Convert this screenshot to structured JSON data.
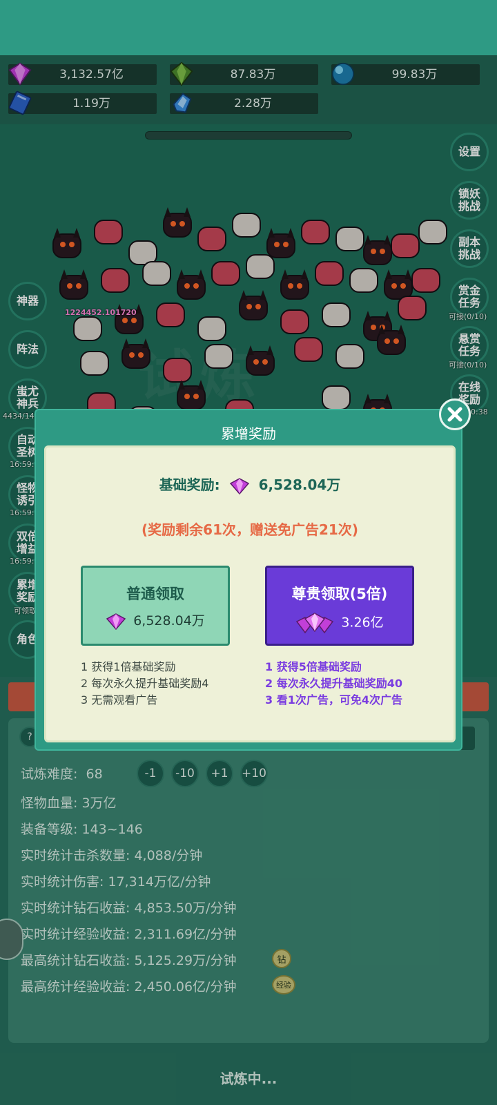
{
  "resources": [
    {
      "name": "diamond",
      "value": "3,132.57亿"
    },
    {
      "name": "green-crystal",
      "value": "87.83万"
    },
    {
      "name": "blue-orb",
      "value": "99.83万"
    },
    {
      "name": "book",
      "value": "1.19万"
    },
    {
      "name": "blue-shard",
      "value": "2.28万"
    }
  ],
  "right_buttons": [
    {
      "label": "设置",
      "sub": ""
    },
    {
      "label": "锁妖挑战",
      "sub": ""
    },
    {
      "label": "副本挑战",
      "sub": ""
    },
    {
      "label": "赏金任务",
      "sub": "可接(0/10)"
    },
    {
      "label": "悬赏任务",
      "sub": "可接(0/10)"
    },
    {
      "label": "在线奖励",
      "sub": "0:38"
    }
  ],
  "left_buttons": [
    {
      "label": "神器",
      "sub": ""
    },
    {
      "label": "阵法",
      "sub": ""
    },
    {
      "label": "蚩尤神兵",
      "sub": "4434/14"
    },
    {
      "label": "自动圣树",
      "sub": "16:59:"
    },
    {
      "label": "怪物诱引",
      "sub": "16:59:"
    },
    {
      "label": "双倍增益",
      "sub": "16:59:"
    },
    {
      "label": "累增奖励",
      "sub": "可领取"
    },
    {
      "label": "角色",
      "sub": ""
    }
  ],
  "damage_text": "1224452.101720",
  "dialog": {
    "title": "累增奖励",
    "base_label": "基础奖励:",
    "base_value": "6,528.04万",
    "remain": "(奖励剩余61次，赠送免广告21次)",
    "normal": {
      "title": "普通领取",
      "amount": "6,528.04万",
      "desc": [
        "1 获得1倍基础奖励",
        "2 每次永久提升基础奖励4",
        "3 无需观看广告"
      ]
    },
    "premium": {
      "title": "尊贵领取(5倍)",
      "amount": "3.26亿",
      "desc": [
        "1 获得5倍基础奖励",
        "2 每次永久提升基础奖励40",
        "3 看1次广告，可免4次广告"
      ]
    }
  },
  "stats": {
    "difficulty_label": "试炼难度:",
    "difficulty_value": "68",
    "adjust": [
      "-1",
      "-10",
      "+1",
      "+10"
    ],
    "lines": [
      "怪物血量: 3万亿",
      "装备等级: 143~146",
      "实时统计击杀数量: 4,088/分钟",
      "实时统计伤害: 17,314万亿/分钟",
      "实时统计钻石收益: 4,853.50万/分钟",
      "实时统计经验收益: 2,311.69亿/分钟",
      "最高统计钻石收益: 5,125.29万/分钟",
      "最高统计经验收益: 2,450.06亿/分钟"
    ],
    "badge_diamond": "钻",
    "badge_exp": "经验"
  },
  "footer_status": "试炼中...",
  "colors": {
    "accent": "#2e9a84",
    "premium": "#6a3bd8",
    "warning": "#e66a46"
  }
}
